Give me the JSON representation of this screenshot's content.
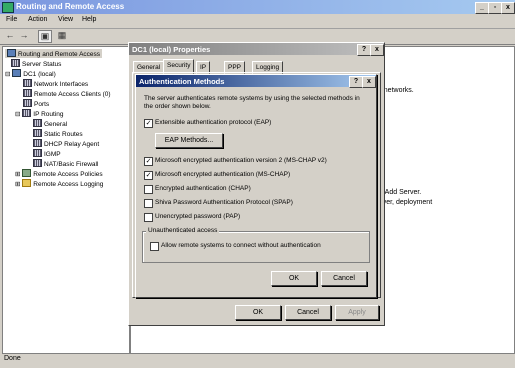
{
  "app": {
    "title": "Routing and Remote Access"
  },
  "menu": [
    "File",
    "Action",
    "View",
    "Help"
  ],
  "window_buttons": [
    "_",
    "▫",
    "x"
  ],
  "tree": [
    {
      "label": "Routing and Remote Access",
      "icon": "server-icon"
    },
    {
      "label": "Server Status",
      "icon": "status-icon"
    },
    {
      "label": "DC1 (local)",
      "icon": "server-icon"
    },
    {
      "label": "Network Interfaces",
      "icon": "network-icon"
    },
    {
      "label": "Remote Access Clients (0)",
      "icon": "clients-icon"
    },
    {
      "label": "Ports",
      "icon": "ports-icon"
    },
    {
      "label": "IP Routing",
      "icon": "routing-icon"
    },
    {
      "label": "General",
      "icon": "general-icon"
    },
    {
      "label": "Static Routes",
      "icon": "routes-icon"
    },
    {
      "label": "DHCP Relay Agent",
      "icon": "relay-icon"
    },
    {
      "label": "IGMP",
      "icon": "igmp-icon"
    },
    {
      "label": "NAT/Basic Firewall",
      "icon": "firewall-icon"
    },
    {
      "label": "Remote Access Policies",
      "icon": "policy-icon"
    },
    {
      "label": "Remote Access Logging",
      "icon": "folder-icon"
    }
  ],
  "right_pane": {
    "line1": "te networks.",
    "line2": "lick Add Server.",
    "line3": "server, deployment"
  },
  "status": {
    "text": "Done"
  },
  "props": {
    "title": "DC1 (local) Properties",
    "tabs": [
      "General",
      "Security",
      "IP",
      "PPP",
      "Logging"
    ],
    "selected_tab": "Security",
    "ok": "OK",
    "cancel": "Cancel",
    "apply": "Apply",
    "help_btn": "?",
    "close_btn": "x"
  },
  "auth": {
    "title": "Authentication Methods",
    "description": "The server authenticates remote systems by using the selected methods in the order shown below.",
    "eap": {
      "label": "Extensible authentication protocol (EAP)",
      "checked": true
    },
    "eap_button": "EAP Methods...",
    "methods": [
      {
        "label": "Microsoft encrypted authentication version 2 (MS-CHAP v2)",
        "checked": true
      },
      {
        "label": "Microsoft encrypted authentication (MS-CHAP)",
        "checked": true
      },
      {
        "label": "Encrypted authentication (CHAP)",
        "checked": false
      },
      {
        "label": "Shiva Password Authentication Protocol (SPAP)",
        "checked": false
      },
      {
        "label": "Unencrypted password (PAP)",
        "checked": false
      }
    ],
    "unauth_group": "Unauthenticated access",
    "unauth": {
      "label": "Allow remote systems to connect without authentication",
      "checked": false
    },
    "ok": "OK",
    "cancel": "Cancel",
    "help_btn": "?",
    "close_btn": "x"
  }
}
